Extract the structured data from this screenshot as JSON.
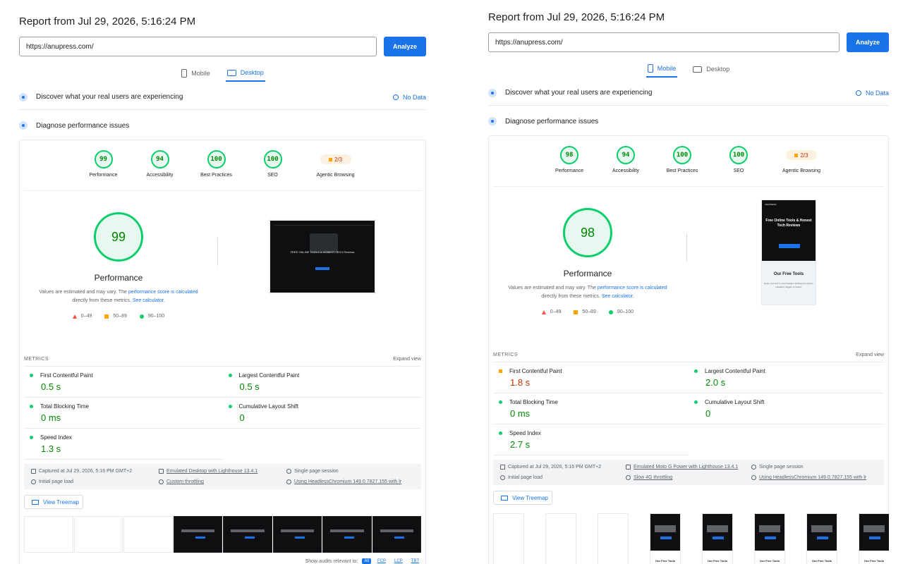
{
  "left": {
    "report_title": "Report from Jul 29, 2026, 5:16:24 PM",
    "url_value": "https://anupress.com/",
    "analyze_label": "Analyze",
    "tabs": [
      {
        "label": "Mobile"
      },
      {
        "label": "Desktop"
      }
    ],
    "active_tab": "Desktop",
    "discover": {
      "title": "Discover what your real users are experiencing",
      "status": "No Data"
    },
    "diagnose": {
      "title": "Diagnose performance issues"
    },
    "gauges": [
      {
        "score": "99",
        "label": "Performance"
      },
      {
        "score": "94",
        "label": "Accessibility"
      },
      {
        "score": "100",
        "label": "Best Practices"
      },
      {
        "score": "100",
        "label": "SEO"
      },
      {
        "score": "2/3",
        "label": "Agentic Browsing",
        "badge": true
      }
    ],
    "perf": {
      "score": "99",
      "label": "Performance",
      "desc_a": "Values are estimated and may vary. The ",
      "desc_link1": "performance score is calculated",
      "desc_b": " directly from these metrics. ",
      "desc_link2": "See calculator."
    },
    "legend": [
      "0–49",
      "50–89",
      "90–100"
    ],
    "screenshot_heading": "FREE ONLINE TOOLS & HONEST TECH Reviews",
    "metrics_head": {
      "title": "METRICS",
      "expand": "Expand view"
    },
    "metrics": [
      {
        "name": "First Contentful Paint",
        "value": "0.5 s",
        "rating": "pass"
      },
      {
        "name": "Largest Contentful Paint",
        "value": "0.5 s",
        "rating": "pass"
      },
      {
        "name": "Total Blocking Time",
        "value": "0 ms",
        "rating": "pass"
      },
      {
        "name": "Cumulative Layout Shift",
        "value": "0",
        "rating": "pass"
      },
      {
        "name": "Speed Index",
        "value": "1.3 s",
        "rating": "pass"
      }
    ],
    "env": [
      "Captured at Jul 29, 2026, 5:16 PM GMT+2",
      "Emulated Desktop with Lighthouse 13.4.1",
      "Single page session",
      "Initial page load",
      "Custom throttling",
      "Using HeadlessChromium 149.0.7827.155 with lr"
    ],
    "treemap_label": "View Treemap",
    "audits": {
      "label": "Show audits relevant to:",
      "chips": [
        "All",
        "FCP",
        "LCP",
        "TBT"
      ]
    }
  },
  "right": {
    "report_title": "Report from Jul 29, 2026, 5:16:24 PM",
    "url_value": "https://anupress.com/",
    "analyze_label": "Analyze",
    "tabs": [
      {
        "label": "Mobile"
      },
      {
        "label": "Desktop"
      }
    ],
    "active_tab": "Mobile",
    "discover": {
      "title": "Discover what your real users are experiencing",
      "status": "No Data"
    },
    "diagnose": {
      "title": "Diagnose performance issues"
    },
    "gauges": [
      {
        "score": "98",
        "label": "Performance"
      },
      {
        "score": "94",
        "label": "Accessibility"
      },
      {
        "score": "100",
        "label": "Best Practices"
      },
      {
        "score": "100",
        "label": "SEO"
      },
      {
        "score": "2/3",
        "label": "Agentic Browsing",
        "badge": true
      }
    ],
    "perf": {
      "score": "98",
      "label": "Performance",
      "desc_a": "Values are estimated and may vary. The ",
      "desc_link1": "performance score is calculated",
      "desc_b": " directly from these metrics. ",
      "desc_link2": "See calculator."
    },
    "legend": [
      "0–49",
      "50–89",
      "90–100"
    ],
    "screenshot": {
      "brand": "ANUPRESS",
      "heading": "Free Online Tools & Honest Tech Reviews",
      "tools_title": "Our Free Tools",
      "tools_sub": "Every tool runs in your browser. Nothing you input is uploaded, logged, or stored."
    },
    "metrics_head": {
      "title": "METRICS",
      "expand": "Expand view"
    },
    "metrics": [
      {
        "name": "First Contentful Paint",
        "value": "1.8 s",
        "rating": "average"
      },
      {
        "name": "Largest Contentful Paint",
        "value": "2.0 s",
        "rating": "pass"
      },
      {
        "name": "Total Blocking Time",
        "value": "0 ms",
        "rating": "pass"
      },
      {
        "name": "Cumulative Layout Shift",
        "value": "0",
        "rating": "pass"
      },
      {
        "name": "Speed Index",
        "value": "2.7 s",
        "rating": "pass"
      }
    ],
    "env": [
      "Captured at Jul 29, 2026, 5:16 PM GMT+2",
      "Emulated Moto G Power with Lighthouse 13.4.1",
      "Single page session",
      "Initial page load",
      "Slow 4G throttling",
      "Using HeadlessChromium 149.0.7827.155 with lr"
    ],
    "treemap_label": "View Treemap",
    "film_label": "Our Free Tools"
  },
  "colors": {
    "pass": "#0cce6b",
    "average": "#ffa400",
    "fail": "#ff4e42",
    "accent": "#1a73e8"
  }
}
